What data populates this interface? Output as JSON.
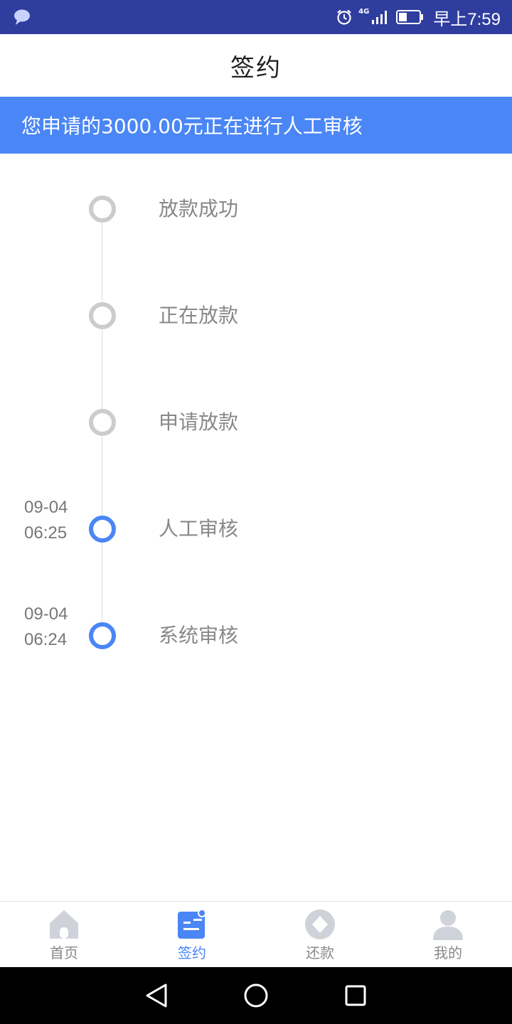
{
  "status_bar": {
    "network": "4G",
    "time": "早上7:59",
    "icons": [
      "message-icon",
      "alarm-icon",
      "signal-icon",
      "battery-icon"
    ]
  },
  "header": {
    "title": "签约"
  },
  "banner": {
    "text": "您申请的3000.00元正在进行人工审核"
  },
  "timeline": {
    "items": [
      {
        "label": "放款成功",
        "date": "",
        "time": "",
        "state": "pending"
      },
      {
        "label": "正在放款",
        "date": "",
        "time": "",
        "state": "pending"
      },
      {
        "label": "申请放款",
        "date": "",
        "time": "",
        "state": "pending"
      },
      {
        "label": "人工审核",
        "date": "09-04",
        "time": "06:25",
        "state": "done"
      },
      {
        "label": "系统审核",
        "date": "09-04",
        "time": "06:24",
        "state": "done"
      }
    ]
  },
  "tab_bar": {
    "tabs": [
      {
        "label": "首页",
        "icon": "home-icon",
        "active": false
      },
      {
        "label": "签约",
        "icon": "contract-icon",
        "active": true
      },
      {
        "label": "还款",
        "icon": "repay-icon",
        "active": false
      },
      {
        "label": "我的",
        "icon": "profile-icon",
        "active": false
      }
    ]
  },
  "colors": {
    "status_bar": "#2f3d9e",
    "accent": "#4a86f5",
    "inactive_dot": "#cccccc",
    "muted_text": "#888888"
  }
}
